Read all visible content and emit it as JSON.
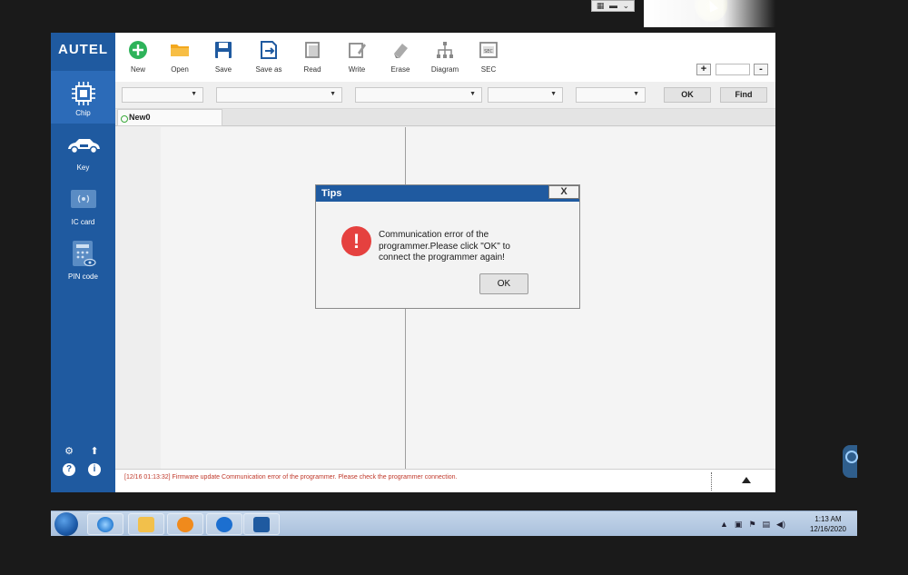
{
  "app": {
    "brand": "AUTEL",
    "sidebar": [
      {
        "label": "Chip",
        "icon": "chip-icon",
        "active": true
      },
      {
        "label": "Key",
        "icon": "car-key-icon",
        "active": false
      },
      {
        "label": "IC card",
        "icon": "ic-card-icon",
        "active": false
      },
      {
        "label": "PIN code",
        "icon": "pin-code-icon",
        "active": false
      }
    ],
    "toolbar": [
      {
        "label": "New",
        "icon": "plus-circle-icon"
      },
      {
        "label": "Open",
        "icon": "folder-icon"
      },
      {
        "label": "Save",
        "icon": "floppy-icon"
      },
      {
        "label": "Save as",
        "icon": "save-as-icon"
      },
      {
        "label": "Read",
        "icon": "read-icon"
      },
      {
        "label": "Write",
        "icon": "write-icon"
      },
      {
        "label": "Erase",
        "icon": "eraser-icon"
      },
      {
        "label": "Diagram",
        "icon": "diagram-icon"
      },
      {
        "label": "SEC",
        "icon": "sec-icon"
      }
    ],
    "zoom": {
      "plus": "+",
      "minus": "-"
    },
    "filters": {
      "ok_label": "OK",
      "find_label": "Find"
    },
    "tab_name": "New0",
    "log_message": "[12/16 01:13:32] Firmware update Communication error of the programmer. Please check the programmer connection."
  },
  "dialog": {
    "title": "Tips",
    "close": "X",
    "icon_glyph": "!",
    "message": "Communication error of the programmer.Please click \"OK\" to connect the programmer again!",
    "ok_label": "OK"
  },
  "taskbar": {
    "time": "1:13 AM",
    "date": "12/16/2020"
  },
  "colors": {
    "brand_blue": "#1f5aa0",
    "error_red": "#e5413f",
    "log_red": "#c0392b"
  }
}
